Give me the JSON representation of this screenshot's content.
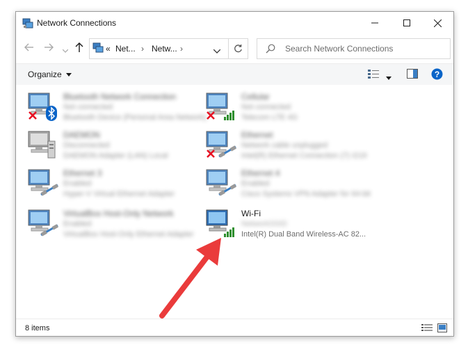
{
  "window": {
    "title": "Network Connections"
  },
  "address": {
    "crumbs": [
      "«",
      "Net...",
      "›",
      "Netw...",
      "›"
    ],
    "chevron": "⌵"
  },
  "search": {
    "placeholder": "Search Network Connections"
  },
  "toolbar": {
    "organize_label": "Organize"
  },
  "items": [
    {
      "name": "Bluetooth Network Connection",
      "status": "Not connected",
      "device": "Bluetooth Device (Personal Area Network)",
      "icon": "monitor-icon",
      "badge": "x",
      "overlay": "bluetooth-icon",
      "blurred": true
    },
    {
      "name": "Cellular",
      "status": "Not connected",
      "device": "Telecom LTE 4G",
      "icon": "monitor-icon",
      "badge": "x",
      "overlay": "signal-bars-icon",
      "blurred": true
    },
    {
      "name": "DAEMON",
      "status": "Disconnected",
      "device": "DAEMON Adapter (LAN) Local",
      "icon": "computer-tower-icon",
      "badge": "",
      "overlay": "",
      "blurred": true
    },
    {
      "name": "Ethernet",
      "status": "Network cable unplugged",
      "device": "Intel(R) Ethernet Connection (7) I219",
      "icon": "monitor-icon",
      "badge": "x",
      "overlay": "ethernet-cable-icon",
      "blurred": true
    },
    {
      "name": "Ethernet 3",
      "status": "Enabled",
      "device": "Hyper-V Virtual Ethernet Adapter",
      "icon": "monitor-icon",
      "badge": "",
      "overlay": "ethernet-cable-icon",
      "blurred": true
    },
    {
      "name": "Ethernet 4",
      "status": "Enabled",
      "device": "Cisco Systems VPN Adapter for 64-bit",
      "icon": "monitor-icon",
      "badge": "",
      "overlay": "ethernet-cable-icon",
      "blurred": true
    },
    {
      "name": "VirtualBox Host-Only Network",
      "status": "Enabled",
      "device": "VirtualBox Host-Only Ethernet Adapter",
      "icon": "monitor-icon",
      "badge": "",
      "overlay": "ethernet-cable-icon",
      "blurred": true
    },
    {
      "name": "Wi-Fi",
      "status": "NetworkSSID",
      "device": "Intel(R) Dual Band Wireless-AC 82...",
      "icon": "monitor-icon",
      "badge": "",
      "overlay": "signal-bars-icon",
      "blurred": false
    }
  ],
  "status": {
    "count_text": "8 items"
  },
  "colors": {
    "accent": "#0a64c8",
    "annotation_arrow": "#ea3b3b",
    "error_x": "#e81123",
    "signal_green": "#2f8f2f"
  }
}
